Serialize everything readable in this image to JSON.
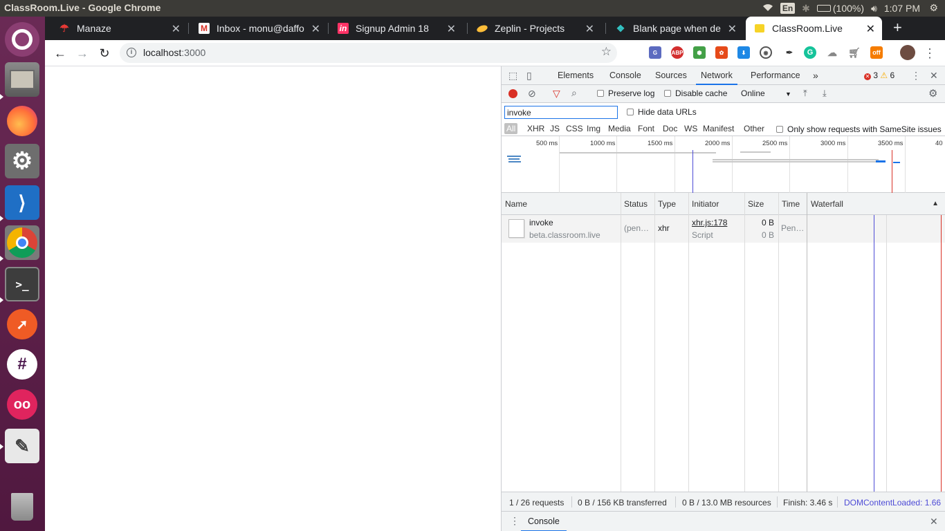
{
  "os": {
    "window_title": "ClassRoom.Live - Google Chrome",
    "lang": "En",
    "battery": "(100%)",
    "clock": "1:07 PM"
  },
  "tabs": [
    {
      "title": "Manaze",
      "icon": "umbrella-icon"
    },
    {
      "title": "Inbox - monu@daffo",
      "icon": "gmail-icon"
    },
    {
      "title": "Signup Admin 18",
      "icon": "invision-icon"
    },
    {
      "title": "Zeplin - Projects",
      "icon": "zeplin-icon"
    },
    {
      "title": "Blank page when de",
      "icon": "stackexchange-icon"
    },
    {
      "title": "ClassRoom.Live",
      "icon": "classroom-icon",
      "active": true
    }
  ],
  "toolbar": {
    "url_host": "localhost",
    "url_port": ":3000"
  },
  "extensions": {
    "abp": "ABP",
    "off": "off"
  },
  "devtools": {
    "tabs": [
      "Elements",
      "Console",
      "Sources",
      "Network",
      "Performance"
    ],
    "more": "»",
    "errors": "3",
    "warnings": "6",
    "preserve_log": "Preserve log",
    "disable_cache": "Disable cache",
    "throttle": "Online",
    "filter_value": "invoke",
    "hide_data_urls": "Hide data URLs",
    "types": [
      "All",
      "XHR",
      "JS",
      "CSS",
      "Img",
      "Media",
      "Font",
      "Doc",
      "WS",
      "Manifest",
      "Other"
    ],
    "samesite": "Only show requests with SameSite issues",
    "ticks": [
      "500 ms",
      "1000 ms",
      "1500 ms",
      "2000 ms",
      "2500 ms",
      "3000 ms",
      "3500 ms",
      "40"
    ],
    "columns": [
      "Name",
      "Status",
      "Type",
      "Initiator",
      "Size",
      "Time",
      "Waterfall"
    ],
    "sort_arrow": "▲",
    "rows": [
      {
        "name": "invoke",
        "domain": "beta.classroom.live",
        "status": "(pen…",
        "type": "xhr",
        "initiator": "xhr.js:178",
        "initiator_type": "Script",
        "size": "0 B",
        "size2": "0 B",
        "time": "Pen…"
      }
    ],
    "status": {
      "requests": "1 / 26 requests",
      "transferred": "0 B / 156 KB transferred",
      "resources": "0 B / 13.0 MB resources",
      "finish": "Finish: 3.46 s",
      "dcl": "DOMContentLoaded: 1.66"
    },
    "drawer_tab": "Console"
  }
}
